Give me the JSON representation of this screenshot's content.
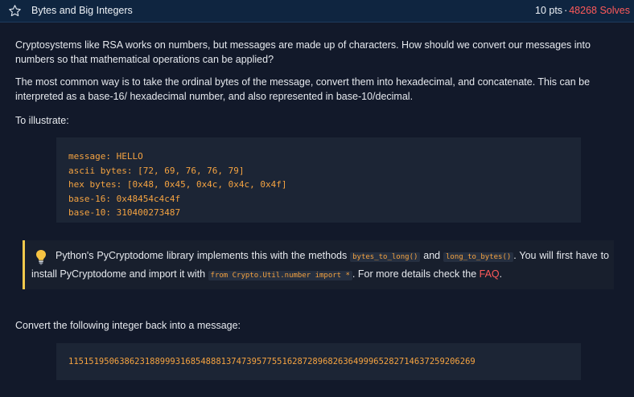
{
  "header": {
    "title": "Bytes and Big Integers",
    "points": "10 pts",
    "separator": "·",
    "solves": "48268 Solves"
  },
  "paragraphs": {
    "intro": "Cryptosystems like RSA works on numbers, but messages are made up of characters. How should we convert our messages into numbers so that mathematical operations can be applied?",
    "method": "The most common way is to take the ordinal bytes of the message, convert them into hexadecimal, and concatenate. This can be interpreted as a base-16/ hexadecimal number, and also represented in base-10/decimal.",
    "illustrate": "To illustrate:",
    "convert": "Convert the following integer back into a message:"
  },
  "example_code": {
    "lines": [
      "message: HELLO",
      "ascii bytes: [72, 69, 76, 76, 79]",
      "hex bytes: [0x48, 0x45, 0x4c, 0x4c, 0x4f]",
      "base-16: 0x48454c4c4f",
      "base-10: 310400273487"
    ]
  },
  "tip": {
    "icon": "lightbulb-icon",
    "part1": "Python's PyCryptodome library implements this with the methods ",
    "code1": "bytes_to_long()",
    "part2": " and ",
    "code2": "long_to_bytes()",
    "part3": ". You will first have to install PyCryptodome and import it with ",
    "code3": "from Crypto.Util.number import *",
    "part4": ". For more details check the ",
    "link": "FAQ",
    "part5": "."
  },
  "challenge_integer": "11515195063862318899931685488813747395775516287289682636499965282714637259206269",
  "colors": {
    "background": "#12192a",
    "header": "#0f2540",
    "code_text": "#f5a341",
    "accent_red": "#ff5a5a",
    "tip_border": "#f2c94c"
  }
}
